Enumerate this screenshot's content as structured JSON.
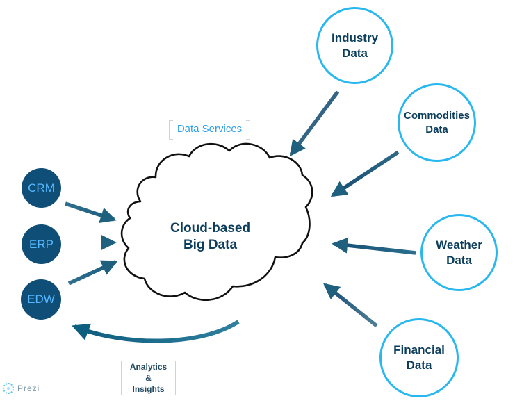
{
  "diagram": {
    "center_label_line_1": "Cloud-based",
    "center_label_line_2": "Big Data",
    "top_label": "[Data Services]",
    "top_label_text": "Data Services",
    "bottom_label_line_1": "Analytics",
    "bottom_label_line_2": "&",
    "bottom_label_line_3": "Insights"
  },
  "left_sources": [
    {
      "label": "CRM"
    },
    {
      "label": "ERP"
    },
    {
      "label": "EDW"
    }
  ],
  "right_sources": [
    {
      "line_1": "Industry",
      "line_2": "Data"
    },
    {
      "line_1": "Commodities",
      "line_2": "Data"
    },
    {
      "line_1": "Weather",
      "line_2": "Data"
    },
    {
      "line_1": "Financial",
      "line_2": "Data"
    }
  ],
  "brand": {
    "name": "Prezi",
    "icon": "prezi-logo-icon",
    "accent_color": "#63c7f1"
  },
  "colors": {
    "dark_node_fill": "#0f4f77",
    "dark_node_text": "#55b7ff",
    "outline_node_border": "#29b7ef",
    "arrow_color": "#1f607e",
    "cloud_stroke": "#111111",
    "text_primary": "#0b3d5c"
  }
}
